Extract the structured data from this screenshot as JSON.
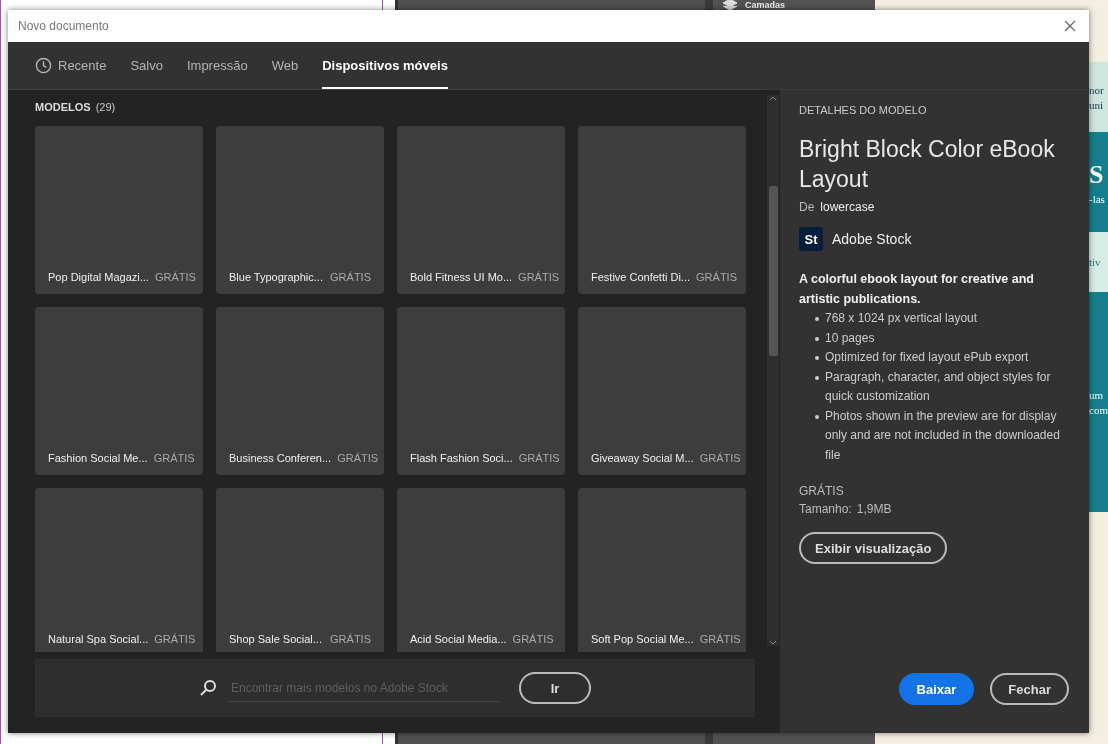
{
  "background": {
    "layers_panel": {
      "title": "Camadas"
    },
    "document": {
      "fragments": [
        "nor",
        "uni",
        "S",
        "-las",
        "tiv",
        "um",
        "com"
      ]
    }
  },
  "window": {
    "title": "Novo documento"
  },
  "tabs": [
    {
      "label": "Recente",
      "kind": "clock",
      "selected": false
    },
    {
      "label": "Salvo",
      "kind": "text",
      "selected": false
    },
    {
      "label": "Impressão",
      "kind": "text",
      "selected": false
    },
    {
      "label": "Web",
      "kind": "text",
      "selected": false
    },
    {
      "label": "Dispositivos móveis",
      "kind": "text",
      "selected": true
    }
  ],
  "templates": {
    "heading": "MODELOS",
    "count": "(29)",
    "items": [
      {
        "name": "Pop Digital Magazi...",
        "price": "GRÁTIS",
        "selected": false
      },
      {
        "name": "Blue Typographic...",
        "price": "GRÁTIS",
        "selected": false
      },
      {
        "name": "Bold Fitness UI Mo...",
        "price": "GRÁTIS",
        "selected": false
      },
      {
        "name": "Festive Confetti Di...",
        "price": "GRÁTIS",
        "selected": false
      },
      {
        "name": "Fashion Social Me...",
        "price": "GRÁTIS",
        "selected": false
      },
      {
        "name": "Business Conferen...",
        "price": "GRÁTIS",
        "selected": false
      },
      {
        "name": "Flash Fashion Soci...",
        "price": "GRÁTIS",
        "selected": false
      },
      {
        "name": "Giveaway Social M...",
        "price": "GRÁTIS",
        "selected": false
      },
      {
        "name": "Natural Spa Social...",
        "price": "GRÁTIS",
        "selected": false
      },
      {
        "name": "Shop Sale Social...",
        "price": "GRÁTIS",
        "selected": false
      },
      {
        "name": "Acid Social Media...",
        "price": "GRÁTIS",
        "selected": false
      },
      {
        "name": "Soft Pop Social Me...",
        "price": "GRÁTIS",
        "selected": false
      }
    ]
  },
  "search": {
    "placeholder": "Encontrar mais modelos no Adobe Stock",
    "button": "Ir"
  },
  "details": {
    "heading": "DETALHES DO MODELO",
    "title": "Bright Block Color eBook Layout",
    "author_label": "De",
    "author": "lowercase",
    "source_badge": "St",
    "source": "Adobe Stock",
    "description": "A colorful ebook layout for creative and artistic publications.",
    "features": [
      "768 x 1024 px vertical layout",
      "10 pages",
      "Optimized for fixed layout ePub export",
      "Paragraph, character, and object styles for quick customization",
      "Photos shown in the preview are for display only and are not included in the downloaded file"
    ],
    "price": "GRÁTIS",
    "size_label": "Tamanho:",
    "size": "1,9MB",
    "preview_button": "Exibir visualização"
  },
  "buttons": [
    {
      "label": "Baixar",
      "kind": "primary"
    },
    {
      "label": "Fechar",
      "kind": "secondary"
    }
  ]
}
